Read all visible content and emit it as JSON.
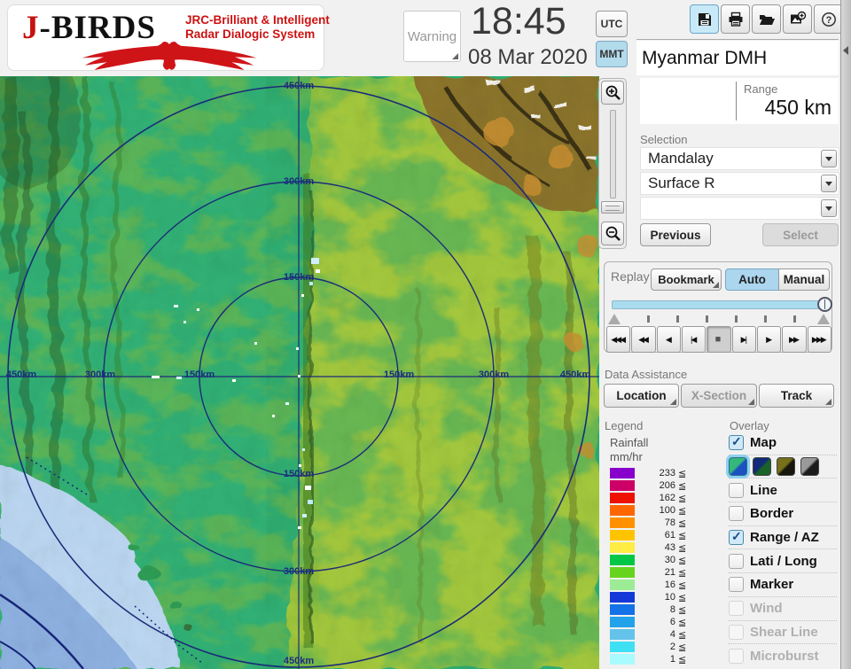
{
  "header": {
    "logo": {
      "title_j": "J",
      "title_rest": "-BIRDS",
      "tagline1": "JRC-Brilliant & Intelligent",
      "tagline2": "Radar  Dialogic  System"
    },
    "warning_label": "Warning",
    "time": "18:45",
    "date": "08 Mar 2020",
    "tz": {
      "utc": "UTC",
      "mmt": "MMT"
    },
    "toolbar_icons": [
      "save",
      "print",
      "open",
      "export",
      "help"
    ],
    "station": "Myanmar DMH"
  },
  "panel": {
    "range": {
      "label": "Range",
      "value": "450 km"
    },
    "selection": {
      "label": "Selection",
      "fields": [
        "Mandalay",
        "Surface R",
        ""
      ]
    },
    "previous_label": "Previous",
    "select_label": "Select",
    "replay": {
      "label": "Replay",
      "bookmark": "Bookmark",
      "auto": "Auto",
      "manual": "Manual"
    },
    "data_assistance": {
      "label": "Data Assistance",
      "buttons": [
        "Location",
        "X-Section",
        "Track"
      ]
    },
    "legend": {
      "label": "Legend",
      "unit_line1": "Rainfall",
      "unit_line2": "mm/hr",
      "symbol": "≦",
      "items": [
        {
          "value": "233",
          "color": "#8800cc"
        },
        {
          "value": "206",
          "color": "#cc0066"
        },
        {
          "value": "162",
          "color": "#ee1100"
        },
        {
          "value": "100",
          "color": "#ff6600"
        },
        {
          "value": "78",
          "color": "#ff9100"
        },
        {
          "value": "61",
          "color": "#ffc400"
        },
        {
          "value": "43",
          "color": "#ffec44"
        },
        {
          "value": "30",
          "color": "#00c846"
        },
        {
          "value": "21",
          "color": "#66d41e"
        },
        {
          "value": "16",
          "color": "#9cec96"
        },
        {
          "value": "10",
          "color": "#1538d8"
        },
        {
          "value": "8",
          "color": "#1472e8"
        },
        {
          "value": "6",
          "color": "#22a2ea"
        },
        {
          "value": "4",
          "color": "#63c3ea"
        },
        {
          "value": "2",
          "color": "#40e0f4"
        },
        {
          "value": "1",
          "color": "#a9fbff"
        }
      ]
    },
    "overlay": {
      "label": "Overlay",
      "items": [
        {
          "label": "Map",
          "state": "checked"
        },
        {
          "label": "Line",
          "state": "unchecked"
        },
        {
          "label": "Border",
          "state": "unchecked"
        },
        {
          "label": "Range / AZ",
          "state": "checked"
        },
        {
          "label": "Lati / Long",
          "state": "unchecked"
        },
        {
          "label": "Marker",
          "state": "unchecked"
        },
        {
          "label": "Wind",
          "state": "disabled"
        },
        {
          "label": "Shear Line",
          "state": "disabled"
        },
        {
          "label": "Microburst",
          "state": "disabled"
        }
      ],
      "map_styles": {
        "selected_index": 0,
        "css": [
          "linear-gradient(135deg,#35b87a 45%,#1d50c0 55%)",
          "linear-gradient(135deg,#122a78 45%,#1a6326 55%)",
          "linear-gradient(135deg,#77701a 45%,#17160c 55%)",
          "linear-gradient(135deg,#9a9a9a 45%,#1c1c1c 55%)"
        ]
      }
    }
  },
  "playback": {
    "buttons": [
      {
        "name": "rewind-fast-button",
        "glyph": "◀◀◀",
        "cls": "pb"
      },
      {
        "name": "rewind-button",
        "glyph": "◀◀",
        "cls": "pb"
      },
      {
        "name": "play-reverse-button",
        "glyph": "◀",
        "cls": "pb"
      },
      {
        "name": "step-back-button",
        "glyph": "|◀",
        "cls": "pb"
      },
      {
        "name": "stop-button",
        "glyph": "■",
        "cls": "pb pressed"
      },
      {
        "name": "step-forward-button",
        "glyph": "▶|",
        "cls": "pb"
      },
      {
        "name": "play-button",
        "glyph": "▶",
        "cls": "pb"
      },
      {
        "name": "forward-button",
        "glyph": "▶▶",
        "cls": "pb"
      },
      {
        "name": "forward-fast-button",
        "glyph": "▶▶▶",
        "cls": "pb"
      }
    ]
  },
  "map": {
    "rings_km": [
      150,
      300,
      450
    ],
    "ring_labels": [
      {
        "text": "450km",
        "style": "left:337px;top:11px"
      },
      {
        "text": "300km",
        "style": "left:337px;top:119px"
      },
      {
        "text": "150km",
        "style": "left:337px;top:227px"
      },
      {
        "text": "150km",
        "style": "left:337px;top:449px"
      },
      {
        "text": "300km",
        "style": "left:337px;top:559px"
      },
      {
        "text": "450km",
        "style": "left:337px;top:660px"
      },
      {
        "text": "450km",
        "style": "left:24px;top:337px"
      },
      {
        "text": "300km",
        "style": "left:113px;top:337px"
      },
      {
        "text": "150km",
        "style": "left:225px;top:337px"
      },
      {
        "text": "150km",
        "style": "left:450px;top:337px"
      },
      {
        "text": "300km",
        "style": "left:557px;top:337px"
      },
      {
        "text": "450km",
        "style": "left:649px;top:337px"
      }
    ]
  }
}
